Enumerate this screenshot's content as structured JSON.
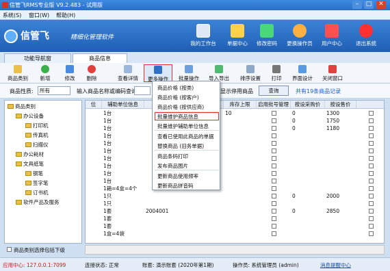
{
  "window": {
    "title": "信管飞RMS专业版 V9.2.483 - 试用版",
    "min": "–",
    "max": "□",
    "close": "✕"
  },
  "menubar": {
    "items": [
      "系统(S)",
      "窗口(W)",
      "帮助(H)"
    ]
  },
  "banner": {
    "logo": "信管飞",
    "slogan": "精细化管理软件",
    "nav": [
      {
        "label": "我的工作台",
        "color": "#ffffff"
      },
      {
        "label": "单据中心",
        "color": "#ffd24a"
      },
      {
        "label": "修改密码",
        "color": "#4ad87a"
      },
      {
        "label": "更换操作员",
        "color": "#ffb040"
      },
      {
        "label": "用户中心",
        "color": "#ff5050"
      },
      {
        "label": "退出系统",
        "color": "#ff3030"
      }
    ]
  },
  "tabs": [
    "功能导航窗",
    "商品信息"
  ],
  "toolbar": {
    "items": [
      "商品类别",
      "新增",
      "修改",
      "删除",
      "查看详情",
      "更多操作",
      "批量操作",
      "导入导出",
      "排序设置",
      "打印",
      "界面设计",
      "关闭窗口"
    ]
  },
  "filter": {
    "prop_label": "商品性质:",
    "prop_value": "所有",
    "search_label": "输入商品名称或编码查询:",
    "search_value": "",
    "show_disabled": "显示停用商品",
    "query_button": "查询",
    "count_text": "共有19条商品记录"
  },
  "tree": {
    "root": "商品类别",
    "nodes": [
      "办公设备",
      "打印机",
      "传真机",
      "扫描仪",
      "办公耗材",
      "文具纸笔",
      "钢笔",
      "签字笔",
      "订书机",
      "软件产品及服务"
    ],
    "footer": "商品类别选择包括下级"
  },
  "grid": {
    "headers": [
      "位",
      "辅助单位信息",
      "",
      "库存上限",
      "启用批号管理",
      "按设采购价",
      "按设售价",
      ""
    ],
    "rows": [
      [
        "1台",
        "",
        "10",
        "☑",
        "0",
        "1300",
        ""
      ],
      [
        "1台",
        "",
        "",
        "",
        "0",
        "1750",
        ""
      ],
      [
        "1台",
        "",
        "",
        "",
        "0",
        "1180",
        ""
      ],
      [
        "1台",
        "",
        "",
        "",
        "",
        "",
        ""
      ],
      [
        "1台",
        "",
        "",
        "",
        "",
        "",
        ""
      ],
      [
        "1台",
        "",
        "",
        "",
        "",
        "",
        ""
      ],
      [
        "1台",
        "",
        "",
        "",
        "",
        "",
        ""
      ],
      [
        "1台",
        "",
        "",
        "",
        "",
        "",
        ""
      ],
      [
        "1台",
        "",
        "",
        "",
        "",
        "",
        ""
      ],
      [
        "1台",
        "",
        "",
        "",
        "",
        "",
        ""
      ],
      [
        "1箱=4盒=4个",
        "",
        "",
        "",
        "",
        "",
        ""
      ],
      [
        "1只",
        "",
        "",
        "",
        "0",
        "2000",
        ""
      ],
      [
        "1只",
        "",
        "",
        "",
        "",
        "",
        ""
      ],
      [
        "1套",
        "2004001",
        "",
        "",
        "0",
        "2850",
        ""
      ],
      [
        "1套",
        "",
        "",
        "",
        "",
        "",
        ""
      ],
      [
        "1套",
        "",
        "",
        "",
        "",
        "",
        ""
      ],
      [
        "1盒=4袋",
        "",
        "",
        "",
        "",
        "",
        ""
      ],
      [
        "1套",
        "",
        "",
        "",
        "",
        "",
        ""
      ]
    ]
  },
  "context_menu": {
    "items": [
      "商品价格 (按类)",
      "商品价格 (按客户)",
      "商品价格 (按供应商)",
      "批量维护商品信息",
      "批量维护辅助单位信息",
      "查看已使用此商品的单据",
      "替换商品 (旧务单据)",
      "商品条码打印",
      "发布商品图片",
      "更新商品使用频率",
      "更新商品拼音码"
    ]
  },
  "statusbar": {
    "app_center": "应用中心: 127.0.0.1:7099",
    "sync": "连接状态: 正常",
    "account": "账套: 演示账套 (2020年第1期)",
    "operator": "操作员: 系统管理员 (admin)",
    "notify": "消息提醒中心"
  }
}
